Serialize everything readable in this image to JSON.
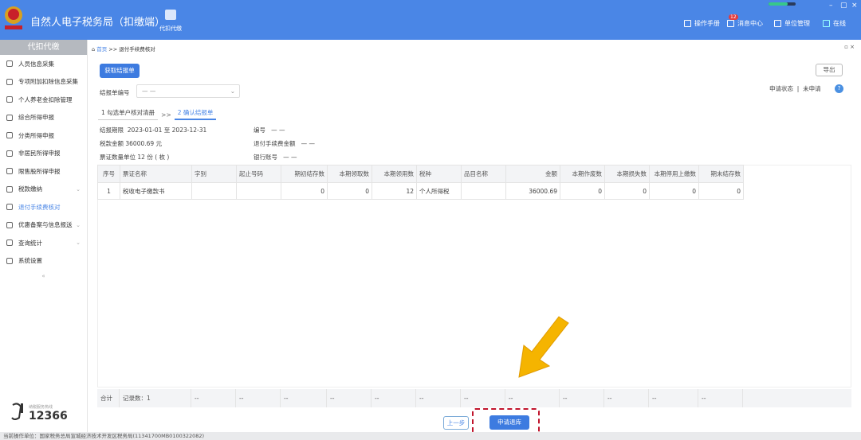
{
  "header": {
    "title": "自然人电子税务局（扣缴端）",
    "module": "代扣代缴",
    "manual": "操作手册",
    "messages": "消息中心",
    "messages_badge": "12",
    "unit_mgmt": "单位管理",
    "online": "在线"
  },
  "sidebar": {
    "title": "代扣代缴",
    "items": [
      {
        "label": "人员信息采集",
        "icon": "person-icon"
      },
      {
        "label": "专项附加扣除信息采集",
        "icon": "list-icon"
      },
      {
        "label": "个人养老金扣除管理",
        "icon": "pension-icon"
      },
      {
        "label": "综合所得申报",
        "icon": "layers-icon"
      },
      {
        "label": "分类所得申报",
        "icon": "pie-icon"
      },
      {
        "label": "非居民所得申报",
        "icon": "user-icon"
      },
      {
        "label": "限售股所得申报",
        "icon": "chart-icon"
      },
      {
        "label": "税款缴纳",
        "icon": "folder-icon",
        "expandable": true
      },
      {
        "label": "退付手续费核对",
        "icon": "doc-icon",
        "active": true
      },
      {
        "label": "优惠备案与信息报送",
        "icon": "file-icon",
        "expandable": true
      },
      {
        "label": "查询统计",
        "icon": "search-list-icon",
        "expandable": true
      },
      {
        "label": "系统设置",
        "icon": "gear-icon"
      }
    ],
    "hotline_label": "纳税服务热线",
    "hotline": "12366"
  },
  "breadcrumb": {
    "home": "首页",
    "sep": ">>",
    "current": "退付手续费核对"
  },
  "toolbar": {
    "fetch": "获取结报单",
    "export": "导出"
  },
  "form": {
    "report_no_label": "结报单编号",
    "report_no_value": "— —",
    "apply_status_label": "申请状态",
    "apply_status_sep": "|",
    "apply_status_value": "未申请"
  },
  "steps": [
    {
      "label": "1 勾选单户核对清册"
    },
    {
      "label": "2 确认结报单",
      "active": true
    }
  ],
  "steps_sep": ">>",
  "info": {
    "period_label": "结报期限",
    "period_from": "2023-01-01",
    "period_to_word": "至",
    "period_to": "2023-12-31",
    "tax_label": "税款金额",
    "tax_value": "36000.69 元",
    "qty_label": "票证数量单位",
    "qty_value": "12 份 ( 枚 )",
    "no_label": "编号",
    "no_value": "— —",
    "fee_label": "退付手续费金额",
    "fee_value": "— —",
    "bank_label": "银行账号",
    "bank_value": "— —"
  },
  "table": {
    "headers": [
      "序号",
      "票证名称",
      "字别",
      "起止号码",
      "期初结存数",
      "本期领取数",
      "本期领用数",
      "税种",
      "品目名称",
      "金额",
      "本期作废数",
      "本期损失数",
      "本期停用上缴数",
      "期末结存数"
    ],
    "rows": [
      [
        "1",
        "税收电子缴款书",
        "",
        "",
        "0",
        "0",
        "12",
        "个人所得税",
        "",
        "36000.69",
        "0",
        "0",
        "0",
        "0"
      ]
    ],
    "footer": {
      "total": "合计",
      "count": "记录数：1",
      "dash": "--"
    }
  },
  "buttons": {
    "prev": "上一步",
    "apply": "申请退库"
  },
  "status_bar": "当前操作单位：国家税务总局宣城经济技术开发区税务局(11341700MB0100322082)",
  "colors": {
    "header": "#4a86e6",
    "primary": "#3d7be0",
    "highlight": "#c0142c",
    "arrow": "#f5b400"
  }
}
